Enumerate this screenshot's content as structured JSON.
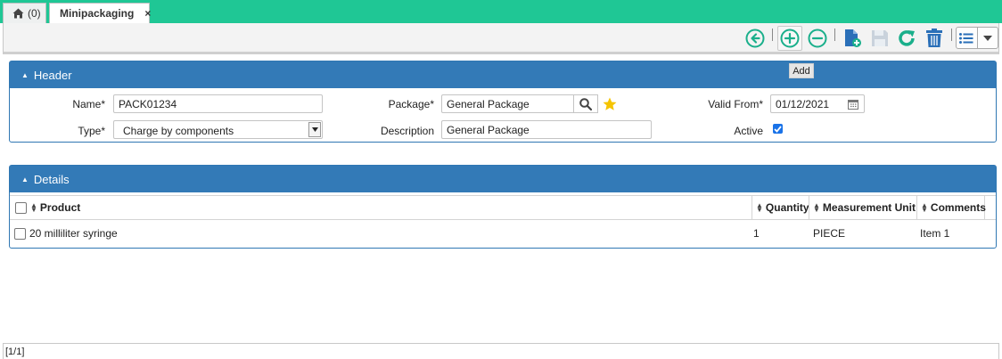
{
  "tabs": {
    "home": {
      "icon": "home-icon",
      "count": "(0)"
    },
    "active": {
      "label": "Minipackaging",
      "close": "×"
    }
  },
  "toolbar": {
    "buttons": [
      {
        "icon": "back-icon",
        "label": "Back"
      },
      {
        "icon": "add-icon",
        "label": "Add"
      },
      {
        "icon": "remove-icon",
        "label": "Remove"
      },
      {
        "icon": "new-document-icon",
        "label": "New"
      },
      {
        "icon": "save-icon",
        "label": "Save"
      },
      {
        "icon": "refresh-icon",
        "label": "Refresh"
      },
      {
        "icon": "delete-icon",
        "label": "Delete"
      },
      {
        "icon": "list-icon",
        "label": "List"
      },
      {
        "icon": "dropdown-caret-icon",
        "label": "More"
      }
    ],
    "tooltip": "Add"
  },
  "header": {
    "title": "Header",
    "name_label": "Name*",
    "name_value": "PACK01234",
    "type_label": "Type*",
    "type_value": "Charge by components",
    "package_label": "Package*",
    "package_value": "General Package",
    "description_label": "Description",
    "description_value": "General Package",
    "valid_from_label": "Valid From*",
    "valid_from_value": "01/12/2021",
    "active_label": "Active",
    "active_checked": true
  },
  "details": {
    "title": "Details",
    "columns": [
      "Product",
      "Quantity",
      "Measurement Unit",
      "Comments"
    ],
    "rows": [
      {
        "product": "20 milliliter syringe",
        "quantity": "1",
        "unit": "PIECE",
        "comments": "Item 1"
      }
    ]
  },
  "status": {
    "pager": "[1/1]"
  },
  "colors": {
    "tabbar": "#1fc795",
    "panel_header": "#337ab7",
    "icon_teal": "#1aaf8b",
    "icon_blue": "#2a6fb8",
    "star": "#f5c400"
  }
}
